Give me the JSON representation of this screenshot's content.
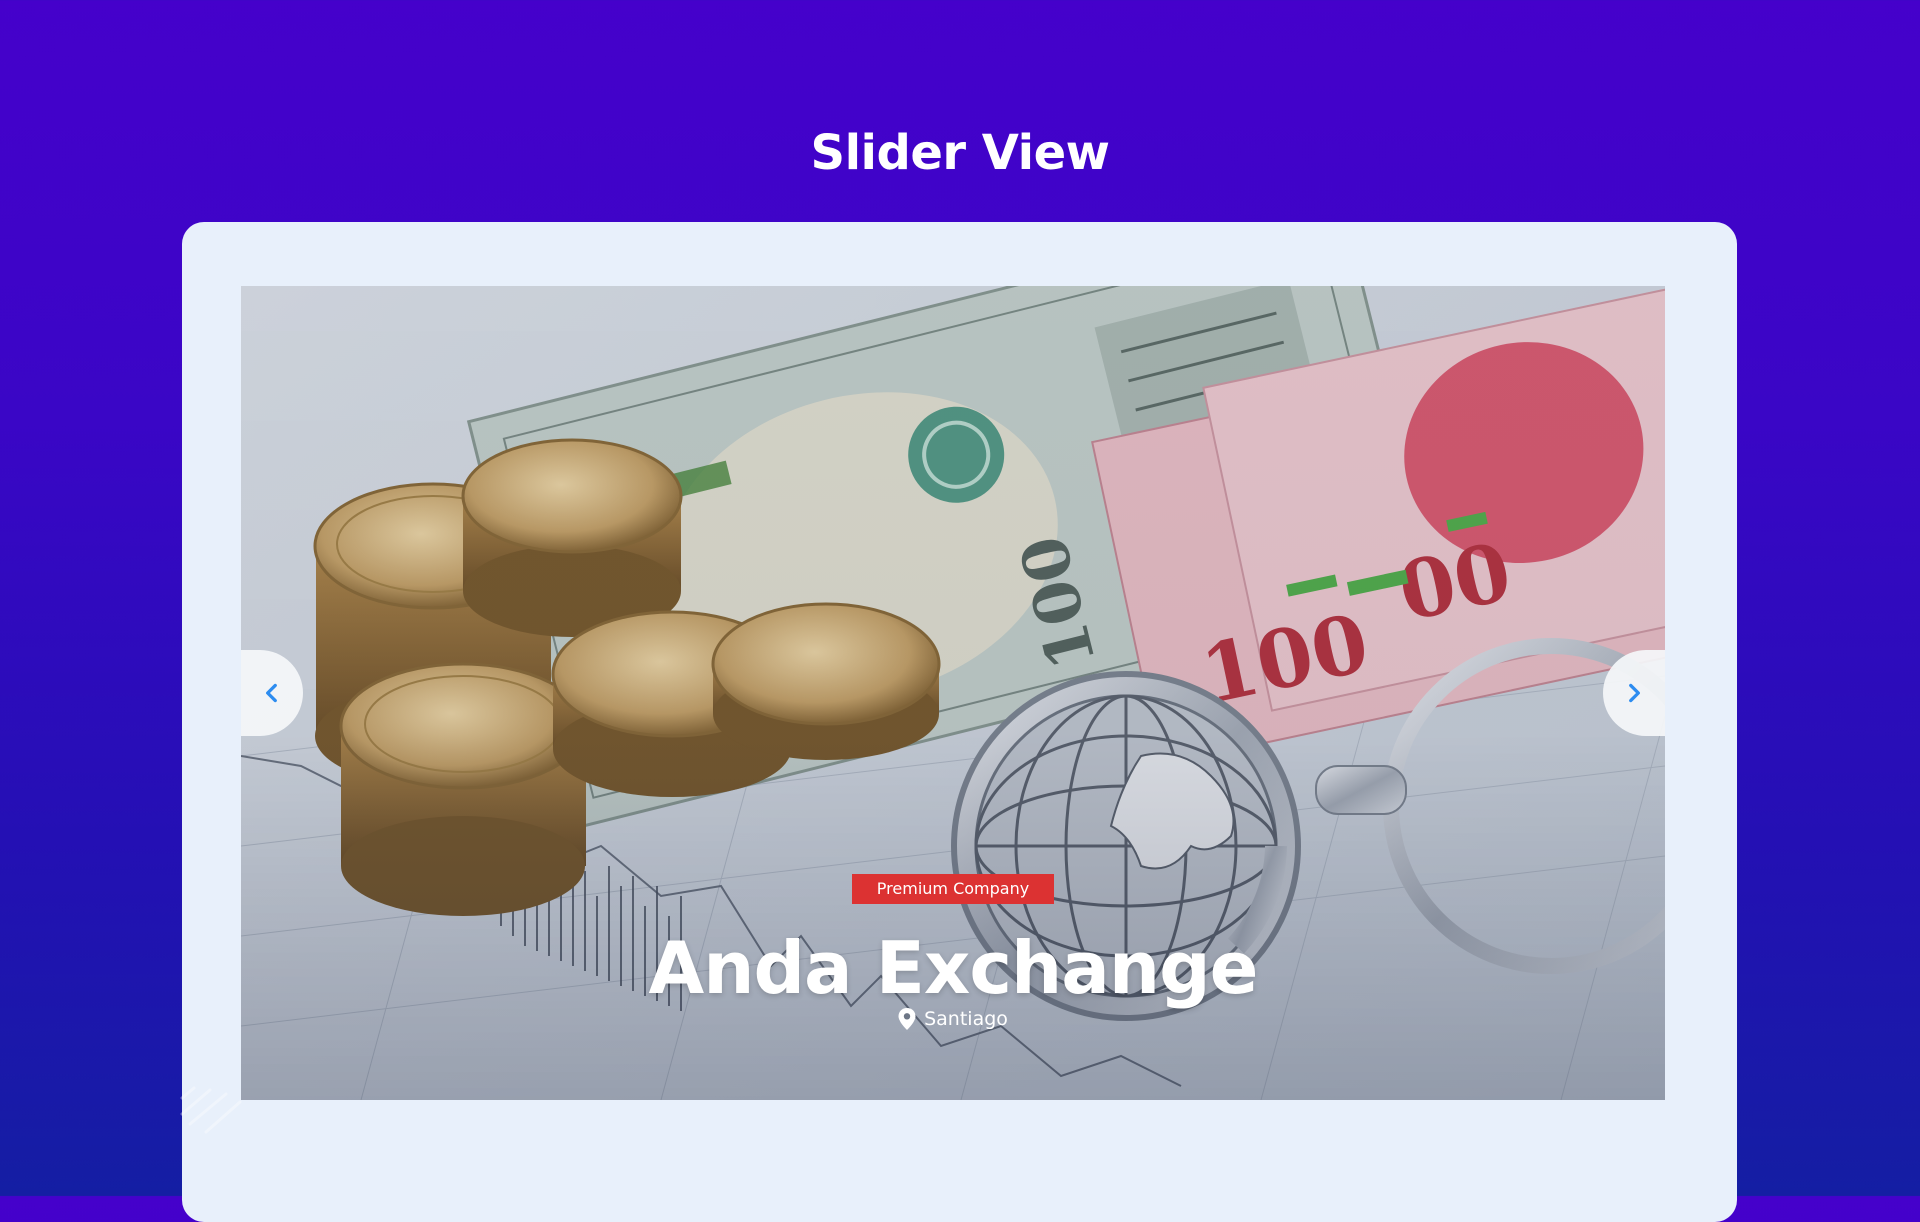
{
  "page": {
    "heading": "Slider View"
  },
  "slider": {
    "image_alt": "Gold coins, banknotes and a globe keyring on a financial chart",
    "prev_icon": "chevron-left-icon",
    "next_icon": "chevron-right-icon",
    "slide": {
      "badge": "Premium Company",
      "title": "Anda Exchange",
      "location": "Santiago",
      "location_icon": "map-pin-icon"
    }
  },
  "colors": {
    "background_top": "#4501cb",
    "background_bottom": "#141ea3",
    "frame": "#e8f0fb",
    "badge": "#dc3232",
    "arrow": "#2d8cf0"
  }
}
